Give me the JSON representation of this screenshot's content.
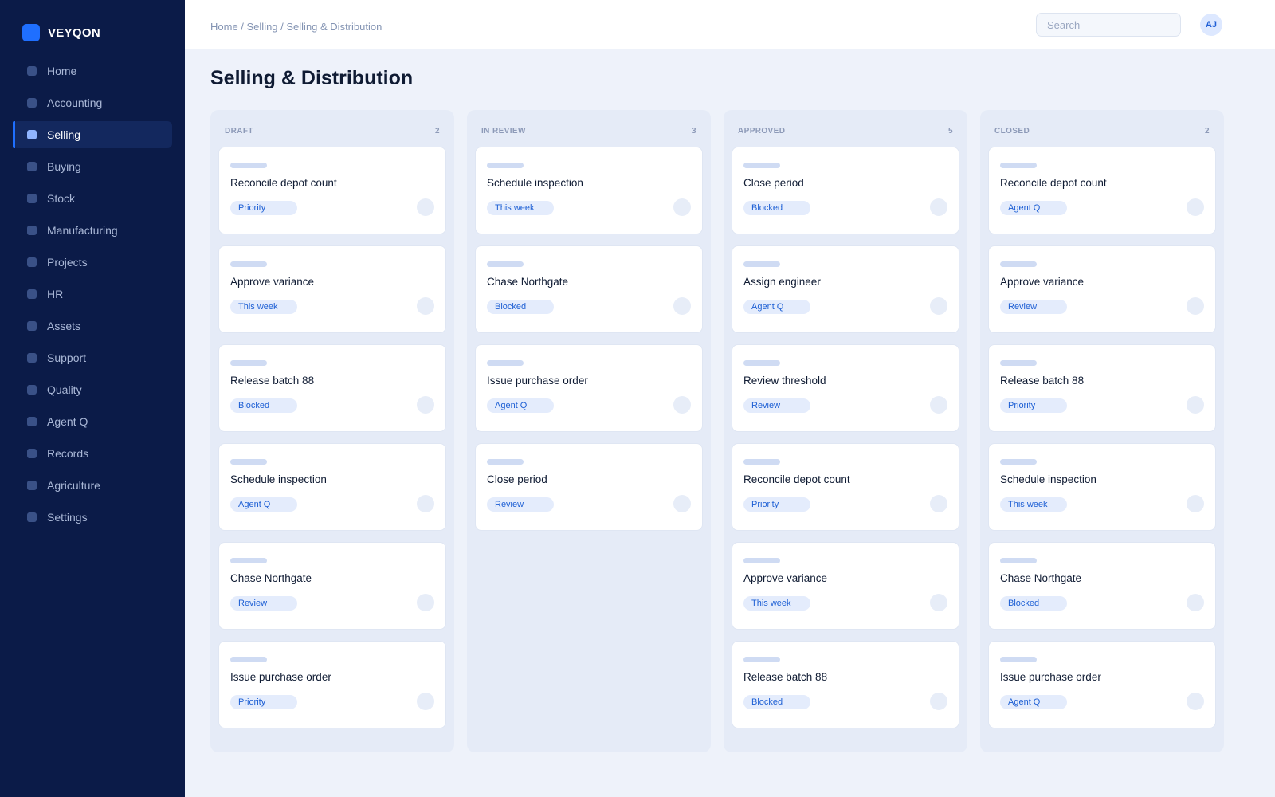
{
  "app": {
    "brand": "VEYQON"
  },
  "sidebar": {
    "items": [
      {
        "label": "Home",
        "icon": "home-icon",
        "active": false
      },
      {
        "label": "Accounting",
        "icon": "accounting-icon",
        "active": false
      },
      {
        "label": "Selling",
        "icon": "selling-icon",
        "active": true
      },
      {
        "label": "Buying",
        "icon": "buying-icon",
        "active": false
      },
      {
        "label": "Stock",
        "icon": "stock-icon",
        "active": false
      },
      {
        "label": "Manufacturing",
        "icon": "manufacturing-icon",
        "active": false
      },
      {
        "label": "Projects",
        "icon": "projects-icon",
        "active": false
      },
      {
        "label": "HR",
        "icon": "hr-icon",
        "active": false
      },
      {
        "label": "Assets",
        "icon": "assets-icon",
        "active": false
      },
      {
        "label": "Support",
        "icon": "support-icon",
        "active": false
      },
      {
        "label": "Quality",
        "icon": "quality-icon",
        "active": false
      },
      {
        "label": "Agent Q",
        "icon": "agent-icon",
        "active": false
      },
      {
        "label": "Records",
        "icon": "records-icon",
        "active": false
      },
      {
        "label": "Agriculture",
        "icon": "agriculture-icon",
        "active": false
      },
      {
        "label": "Settings",
        "icon": "settings-icon",
        "active": false
      }
    ]
  },
  "header": {
    "breadcrumb": "Home / Selling / Selling & Distribution",
    "search_placeholder": "Search",
    "search_value": "",
    "avatar_initials": "AJ"
  },
  "main": {
    "title": "Selling & Distribution"
  },
  "colors": {
    "sidebar_bg": "#0b1b48",
    "accent": "#1f6fff",
    "tag_bg": "#e4ecfc",
    "tag_text": "#1d5fd4"
  },
  "board": {
    "columns": [
      {
        "name": "DRAFT",
        "count": "2",
        "cards": [
          {
            "title": "Reconcile depot count",
            "tag": "Priority"
          },
          {
            "title": "Approve variance",
            "tag": "This week"
          },
          {
            "title": "Release batch 88",
            "tag": "Blocked"
          },
          {
            "title": "Schedule inspection",
            "tag": "Agent Q"
          },
          {
            "title": "Chase Northgate",
            "tag": "Review"
          },
          {
            "title": "Issue purchase order",
            "tag": "Priority"
          }
        ]
      },
      {
        "name": "IN REVIEW",
        "count": "3",
        "cards": [
          {
            "title": "Schedule inspection",
            "tag": "This week"
          },
          {
            "title": "Chase Northgate",
            "tag": "Blocked"
          },
          {
            "title": "Issue purchase order",
            "tag": "Agent Q"
          },
          {
            "title": "Close period",
            "tag": "Review"
          }
        ]
      },
      {
        "name": "APPROVED",
        "count": "5",
        "cards": [
          {
            "title": "Close period",
            "tag": "Blocked"
          },
          {
            "title": "Assign engineer",
            "tag": "Agent Q"
          },
          {
            "title": "Review threshold",
            "tag": "Review"
          },
          {
            "title": "Reconcile depot count",
            "tag": "Priority"
          },
          {
            "title": "Approve variance",
            "tag": "This week"
          },
          {
            "title": "Release batch 88",
            "tag": "Blocked"
          }
        ]
      },
      {
        "name": "CLOSED",
        "count": "2",
        "cards": [
          {
            "title": "Reconcile depot count",
            "tag": "Agent Q"
          },
          {
            "title": "Approve variance",
            "tag": "Review"
          },
          {
            "title": "Release batch 88",
            "tag": "Priority"
          },
          {
            "title": "Schedule inspection",
            "tag": "This week"
          },
          {
            "title": "Chase Northgate",
            "tag": "Blocked"
          },
          {
            "title": "Issue purchase order",
            "tag": "Agent Q"
          }
        ]
      }
    ]
  }
}
